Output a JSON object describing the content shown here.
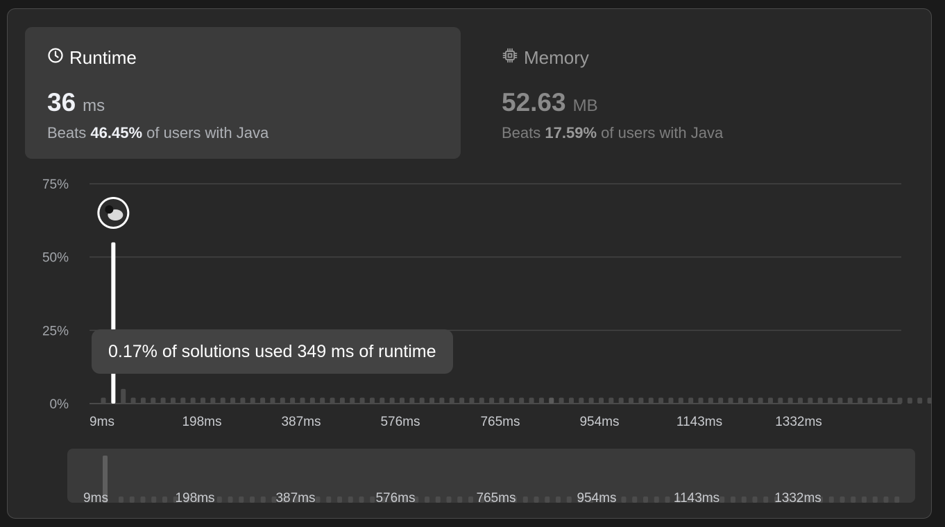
{
  "runtime": {
    "title": "Runtime",
    "value": "36",
    "unit": "ms",
    "beats_prefix": "Beats",
    "beats_pct": "46.45%",
    "beats_suffix": "of users with Java"
  },
  "memory": {
    "title": "Memory",
    "value": "52.63",
    "unit": "MB",
    "beats_prefix": "Beats",
    "beats_pct": "17.59%",
    "beats_suffix": "of users with Java"
  },
  "tooltip": {
    "text": "0.17% of solutions used 349 ms of runtime"
  },
  "colors": {
    "panel_bg": "#282828",
    "card_active": "#3b3b3b",
    "bar": "#4a4a4a",
    "highlight_bar": "#ffffff",
    "gridline": "#444444"
  },
  "chart_data": {
    "type": "bar",
    "ylabel": "",
    "xlabel": "",
    "ylim": [
      0,
      75
    ],
    "y_ticks": [
      "75%",
      "50%",
      "25%",
      "0%"
    ],
    "x_ticks": [
      "9ms",
      "198ms",
      "387ms",
      "576ms",
      "765ms",
      "954ms",
      "1143ms",
      "1332ms"
    ],
    "x_start": 9,
    "bin_width_ms": 21,
    "values": [
      2,
      55,
      5,
      2,
      2,
      2,
      2,
      2,
      2,
      2,
      2,
      2,
      2,
      2,
      2,
      2,
      2,
      2,
      2,
      2,
      2,
      2,
      2,
      2,
      2,
      2,
      2,
      2,
      2,
      2,
      2,
      2,
      2,
      2,
      2,
      2,
      2,
      2,
      2,
      2,
      2,
      2,
      2,
      2,
      2,
      2,
      2,
      2,
      2,
      2,
      2,
      2,
      2,
      2,
      2,
      2,
      2,
      2,
      2,
      2,
      2,
      2,
      2,
      2,
      2,
      2,
      2,
      2,
      2,
      2,
      2,
      2,
      2,
      2,
      2,
      2,
      2,
      2,
      2,
      2,
      2,
      2,
      2,
      2,
      2,
      2,
      2,
      2,
      2,
      2,
      2,
      2,
      2,
      2,
      2,
      2,
      2,
      2
    ],
    "values_note_index_highlight": 1,
    "your_runtime_ms": 36,
    "avatar": "user-avatar",
    "minimap_ticks": [
      "9ms",
      "198ms",
      "387ms",
      "576ms",
      "765ms",
      "954ms",
      "1143ms",
      "1332ms"
    ]
  }
}
